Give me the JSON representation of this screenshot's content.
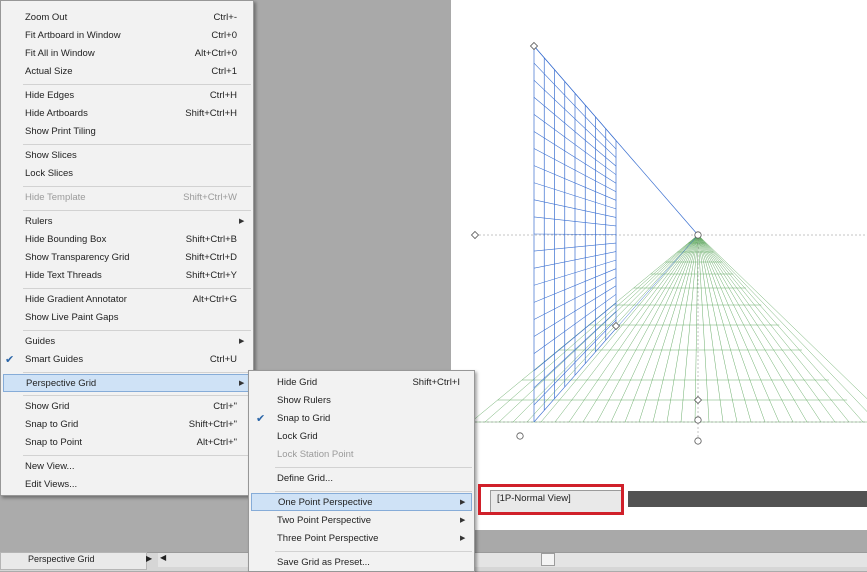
{
  "main_menu": {
    "items": [
      {
        "label": "Zoom Out",
        "shortcut": "Ctrl+-"
      },
      {
        "label": "Fit Artboard in Window",
        "shortcut": "Ctrl+0"
      },
      {
        "label": "Fit All in Window",
        "shortcut": "Alt+Ctrl+0"
      },
      {
        "label": "Actual Size",
        "shortcut": "Ctrl+1"
      },
      {
        "label": "Hide Edges",
        "shortcut": "Ctrl+H"
      },
      {
        "label": "Hide Artboards",
        "shortcut": "Shift+Ctrl+H"
      },
      {
        "label": "Show Print Tiling",
        "shortcut": ""
      },
      {
        "label": "Show Slices",
        "shortcut": ""
      },
      {
        "label": "Lock Slices",
        "shortcut": ""
      },
      {
        "label": "Hide Template",
        "shortcut": "Shift+Ctrl+W",
        "disabled": true
      },
      {
        "label": "Rulers",
        "shortcut": ""
      },
      {
        "label": "Hide Bounding Box",
        "shortcut": "Shift+Ctrl+B"
      },
      {
        "label": "Show Transparency Grid",
        "shortcut": "Shift+Ctrl+D"
      },
      {
        "label": "Hide Text Threads",
        "shortcut": "Shift+Ctrl+Y"
      },
      {
        "label": "Hide Gradient Annotator",
        "shortcut": "Alt+Ctrl+G"
      },
      {
        "label": "Show Live Paint Gaps",
        "shortcut": ""
      },
      {
        "label": "Guides",
        "shortcut": ""
      },
      {
        "label": "Smart Guides",
        "shortcut": "Ctrl+U",
        "checked": true
      },
      {
        "label": "Perspective Grid",
        "shortcut": ""
      },
      {
        "label": "Show Grid",
        "shortcut": "Ctrl+\""
      },
      {
        "label": "Snap to Grid",
        "shortcut": "Shift+Ctrl+\""
      },
      {
        "label": "Snap to Point",
        "shortcut": "Alt+Ctrl+\""
      },
      {
        "label": "New View...",
        "shortcut": ""
      },
      {
        "label": "Edit Views...",
        "shortcut": ""
      }
    ]
  },
  "perspective_submenu": {
    "items": [
      {
        "label": "Hide Grid",
        "shortcut": "Shift+Ctrl+I"
      },
      {
        "label": "Show Rulers",
        "shortcut": ""
      },
      {
        "label": "Snap to Grid",
        "shortcut": "",
        "checked": true
      },
      {
        "label": "Lock Grid",
        "shortcut": ""
      },
      {
        "label": "Lock Station Point",
        "shortcut": "",
        "disabled": true
      },
      {
        "label": "Define Grid...",
        "shortcut": ""
      },
      {
        "label": "One Point Perspective",
        "shortcut": ""
      },
      {
        "label": "Two Point Perspective",
        "shortcut": ""
      },
      {
        "label": "Three Point Perspective",
        "shortcut": ""
      },
      {
        "label": "Save Grid as Preset...",
        "shortcut": ""
      }
    ]
  },
  "one_point_submenu": {
    "items": [
      {
        "label": "[1P-Normal View]"
      }
    ]
  },
  "status_bar": {
    "tool_label": "Perspective Grid"
  },
  "icons": {
    "check": "✔",
    "submenu_arrow": "▶",
    "scroll_left": "◀"
  },
  "colors": {
    "highlight": "#cfe2f6",
    "annotation_red": "#d0202a",
    "grid_blue": "#3a6fd0",
    "grid_green": "#5aa55a"
  }
}
